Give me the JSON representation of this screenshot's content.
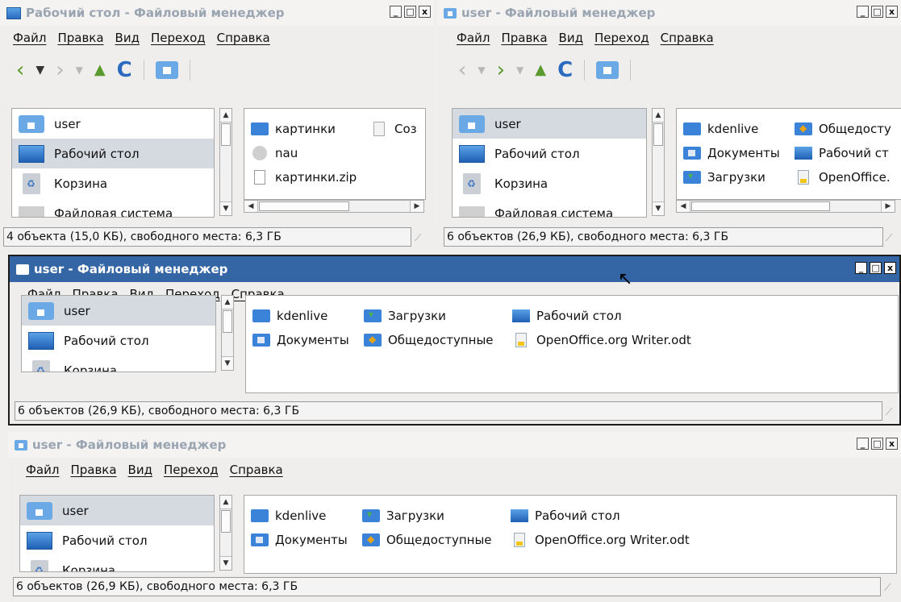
{
  "menu": [
    "Файл",
    "Правка",
    "Вид",
    "Переход",
    "Справка"
  ],
  "window_buttons": [
    "_",
    "□",
    "x"
  ],
  "windows": {
    "w1": {
      "title": "Рабочий стол - Файловый менеджер",
      "sidebar": [
        "user",
        "Рабочий стол",
        "Корзина",
        "Файловая система"
      ],
      "files": [
        {
          "name": "картинки",
          "icon": "folder-icon"
        },
        {
          "name": "nau",
          "icon": "gear-icon"
        },
        {
          "name": "картинки.zip",
          "icon": "zip-icon"
        },
        {
          "name": "Соз",
          "icon": "text-file-icon"
        }
      ],
      "status": "4 объекта (15,0 КБ), свободного места: 6,3 ГБ"
    },
    "w2": {
      "title": "user - Файловый менеджер",
      "sidebar": [
        "user",
        "Рабочий стол",
        "Корзина",
        "Файловая система"
      ],
      "files": [
        {
          "name": "kdenlive",
          "icon": "folder-icon"
        },
        {
          "name": "Документы",
          "icon": "documents-folder-icon"
        },
        {
          "name": "Загрузки",
          "icon": "downloads-folder-icon"
        },
        {
          "name": "Общедосту",
          "icon": "public-folder-icon"
        },
        {
          "name": "Рабочий ст",
          "icon": "desktop-icon"
        },
        {
          "name": "OpenOffice.",
          "icon": "odt-file-icon"
        }
      ],
      "status": "6 объектов (26,9 КБ), свободного места: 6,3 ГБ"
    },
    "w3": {
      "title": "user - Файловый менеджер",
      "sidebar": [
        "user",
        "Рабочий стол",
        "Корзина"
      ],
      "files": [
        {
          "name": "kdenlive",
          "icon": "folder-icon"
        },
        {
          "name": "Документы",
          "icon": "documents-folder-icon"
        },
        {
          "name": "Загрузки",
          "icon": "downloads-folder-icon"
        },
        {
          "name": "Общедоступные",
          "icon": "public-folder-icon"
        },
        {
          "name": "Рабочий стол",
          "icon": "desktop-icon"
        },
        {
          "name": "OpenOffice.org Writer.odt",
          "icon": "odt-file-icon"
        }
      ],
      "status": "6 объектов (26,9 КБ), свободного места: 6,3 ГБ"
    },
    "w4": {
      "title": "user - Файловый менеджер",
      "sidebar": [
        "user",
        "Рабочий стол",
        "Корзина"
      ],
      "files": [
        {
          "name": "kdenlive",
          "icon": "folder-icon"
        },
        {
          "name": "Документы",
          "icon": "documents-folder-icon"
        },
        {
          "name": "Загрузки",
          "icon": "downloads-folder-icon"
        },
        {
          "name": "Общедоступные",
          "icon": "public-folder-icon"
        },
        {
          "name": "Рабочий стол",
          "icon": "desktop-icon"
        },
        {
          "name": "OpenOffice.org Writer.odt",
          "icon": "odt-file-icon"
        }
      ],
      "status": "6 объектов (26,9 КБ), свободного места: 6,3 ГБ"
    }
  },
  "colors": {
    "active_title": "#3465a4",
    "inactive_title_text": "#9aa5b1",
    "selection": "#d5d9e0"
  }
}
